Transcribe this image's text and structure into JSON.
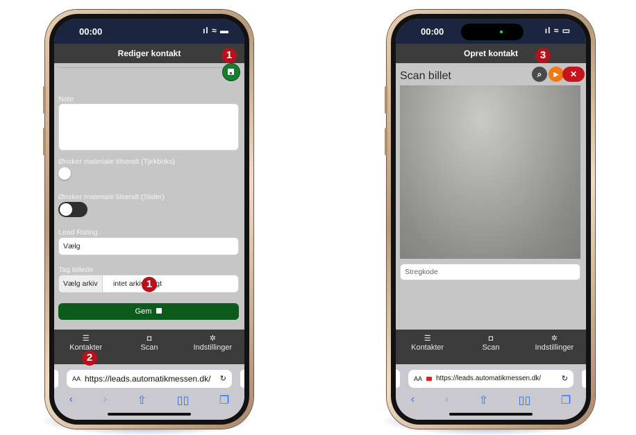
{
  "left_phone": {
    "status_time": "00:00",
    "nav_title": "Rediger kontakt",
    "note_label": "Note",
    "checkbox_label": "Ønsker materiale tilsendt (Tjekboks)",
    "slider_label": "Ønsker materiale tilsendt (Slider)",
    "lead_rating_label": "Lead Rating",
    "lead_rating_value": "Vælg",
    "photo_label": "Tag billede",
    "file_button": "Vælg arkiv",
    "file_status": "intet arkiv valgt",
    "save_button": "Gem",
    "tabs": [
      "Kontakter",
      "Scan",
      "Indstillinger"
    ],
    "url_aa": "AA",
    "url": "https://leads.automatikmessen.dk/",
    "badges": [
      "1",
      "1",
      "2"
    ]
  },
  "right_phone": {
    "status_time": "00:00",
    "nav_title": "Opret kontakt",
    "scan_title": "Scan billet",
    "barcode_placeholder": "Stregkode",
    "tabs": [
      "Kontakter",
      "Scan",
      "Indstillinger"
    ],
    "url_aa": "AA",
    "url": "https://leads.automatikmessen.dk/",
    "badge": "3"
  },
  "icons": {
    "list": "list-icon",
    "camera": "camera-icon",
    "gear": "gear-icon",
    "save": "floppy-disk-icon",
    "search": "search-icon",
    "play": "play-icon",
    "close": "close-icon",
    "reload": "reload-icon"
  },
  "colors": {
    "badge_red": "#b5121b",
    "save_green": "#0d5a1d",
    "navbar_dark": "#3c3c3c",
    "status_navy": "#1c2540",
    "play_orange": "#f07a12"
  }
}
